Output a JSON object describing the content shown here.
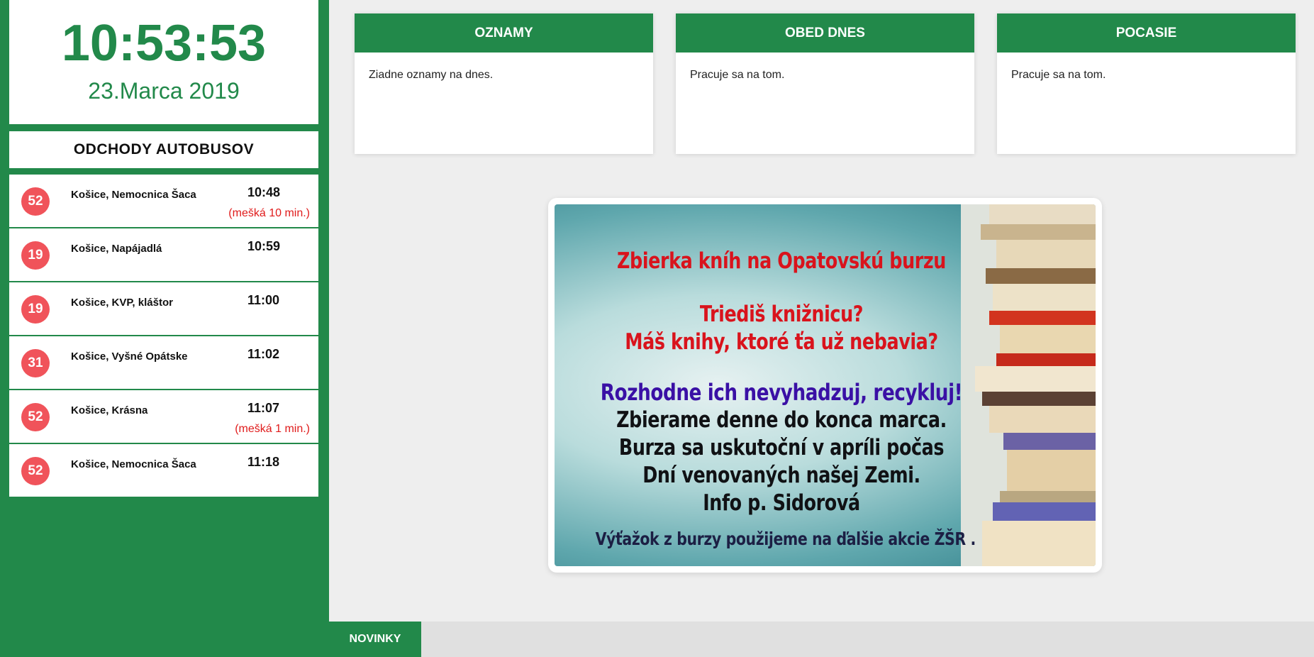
{
  "clock": {
    "time": "10:53:53",
    "date": "23.Marca 2019"
  },
  "buses": {
    "title": "ODCHODY AUTOBUSOV",
    "rows": [
      {
        "line": "52",
        "destination": "Košice, Nemocnica Šaca",
        "time": "10:48",
        "delay": "(mešká 10 min.)"
      },
      {
        "line": "19",
        "destination": "Košice, Napájadlá",
        "time": "10:59",
        "delay": ""
      },
      {
        "line": "19",
        "destination": "Košice, KVP, kláštor",
        "time": "11:00",
        "delay": ""
      },
      {
        "line": "31",
        "destination": "Košice, Vyšné Opátske",
        "time": "11:02",
        "delay": ""
      },
      {
        "line": "52",
        "destination": "Košice, Krásna",
        "time": "11:07",
        "delay": "(mešká 1 min.)"
      },
      {
        "line": "52",
        "destination": "Košice, Nemocnica Šaca",
        "time": "11:18",
        "delay": ""
      }
    ]
  },
  "cards": {
    "announcements": {
      "title": "OZNAMY",
      "body": "Ziadne oznamy na dnes."
    },
    "lunch": {
      "title": "OBED DNES",
      "body": "Pracuje sa na tom."
    },
    "weather": {
      "title": "POCASIE",
      "body": "Pracuje sa na tom."
    }
  },
  "poster": {
    "line1": "Zbierka kníh na Opatovskú burzu",
    "line2": "Triediš knižnicu?",
    "line3": "Máš knihy, ktoré ťa už nebavia?",
    "line4": "Rozhodne ich nevyhadzuj, recykluj!",
    "line5": "Zbierame denne do konca marca.",
    "line6": "Burza sa uskutoční v apríli počas",
    "line7": "Dní venovaných našej Zemi.",
    "line8": "Info p. Sidorová",
    "line9": "Výťažok z burzy použijeme na ďalšie akcie ŽŠR ."
  },
  "ticker": {
    "label": "NOVINKY"
  },
  "colors": {
    "brand_green": "#22894a",
    "badge_red": "#f0535a",
    "delay_red": "#e01b1b",
    "background": "#eeeeee"
  }
}
